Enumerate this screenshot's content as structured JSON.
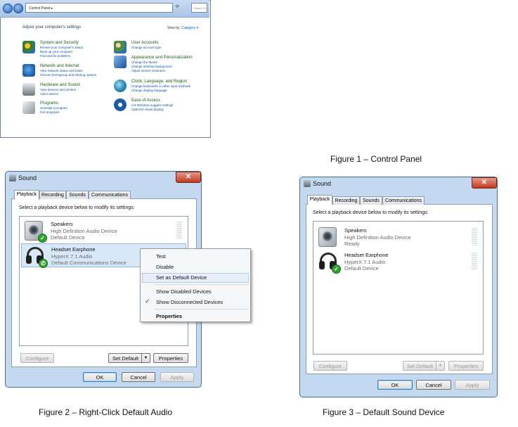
{
  "figure1": {
    "caption": "Figure 1 – Control Panel",
    "address": "Control Panel ▸",
    "search_placeholder": "Search Contro...",
    "heading": "Adjust your computer's settings",
    "view_by_label": "View by:",
    "view_by_value": "Category ▾",
    "categories": [
      {
        "title": "System and Security",
        "links": [
          "Review your computer's status",
          "Back up your computer",
          "Find and fix problems"
        ],
        "icon": "shield-icon",
        "color": "#3a7d2e"
      },
      {
        "title": "Network and Internet",
        "links": [
          "View network status and tasks",
          "Choose homegroup and sharing options"
        ],
        "icon": "network-icon",
        "color": "#2d6db5"
      },
      {
        "title": "Hardware and Sound",
        "links": [
          "View devices and printers",
          "Add a device"
        ],
        "icon": "printer-icon",
        "color": "#5c6670"
      },
      {
        "title": "Programs",
        "links": [
          "Uninstall a program",
          "Get programs"
        ],
        "icon": "programs-icon",
        "color": "#7a7f86"
      },
      {
        "title": "User Accounts",
        "links": [
          "Change account type"
        ],
        "icon": "users-icon",
        "color": "#4f8b3a"
      },
      {
        "title": "Appearance and Personalization",
        "links": [
          "Change the theme",
          "Change desktop background",
          "Adjust screen resolution"
        ],
        "icon": "appearance-icon",
        "color": "#2f5fa8"
      },
      {
        "title": "Clock, Language, and Region",
        "links": [
          "Change keyboards or other input methods",
          "Change display language"
        ],
        "icon": "globe-icon",
        "color": "#2b7f9c"
      },
      {
        "title": "Ease of Access",
        "links": [
          "Let Windows suggest settings",
          "Optimize visual display"
        ],
        "icon": "ease-icon",
        "color": "#1f5aa6"
      }
    ]
  },
  "figure2": {
    "caption": "Figure 2 – Right-Click Default Audio",
    "window_title": "Sound",
    "tabs": [
      "Playback",
      "Recording",
      "Sounds",
      "Communications"
    ],
    "instruction": "Select a playback device below to modify its settings:",
    "devices": [
      {
        "name": "Speakers",
        "line2": "High Definition Audio Device",
        "line3": "Default Device"
      },
      {
        "name": "Headset Earphone",
        "line2": "HyperX 7.1 Audio",
        "line3": "Default Communications Device"
      }
    ],
    "context_menu": {
      "items": [
        "Test",
        "Disable",
        "Set as Default Device",
        "Show Disabled Devices",
        "Show Disconnected Devices",
        "Properties"
      ],
      "checked": "Show Disconnected Devices"
    },
    "buttons": {
      "configure": "Configure",
      "set_default": "Set Default",
      "properties": "Properties",
      "ok": "OK",
      "cancel": "Cancel",
      "apply": "Apply"
    }
  },
  "figure3": {
    "caption": "Figure 3 – Default Sound Device",
    "window_title": "Sound",
    "tabs": [
      "Playback",
      "Recording",
      "Sounds",
      "Communications"
    ],
    "instruction": "Select a playback device below to modify its settings:",
    "devices": [
      {
        "name": "Speakers",
        "line2": "High Definition Audio Device",
        "line3": "Ready"
      },
      {
        "name": "Headset Earphone",
        "line2": "HyperX 7.1 Audio",
        "line3": "Default Device"
      }
    ],
    "buttons": {
      "configure": "Configure",
      "set_default": "Set Default",
      "properties": "Properties",
      "ok": "OK",
      "cancel": "Cancel",
      "apply": "Apply"
    }
  }
}
